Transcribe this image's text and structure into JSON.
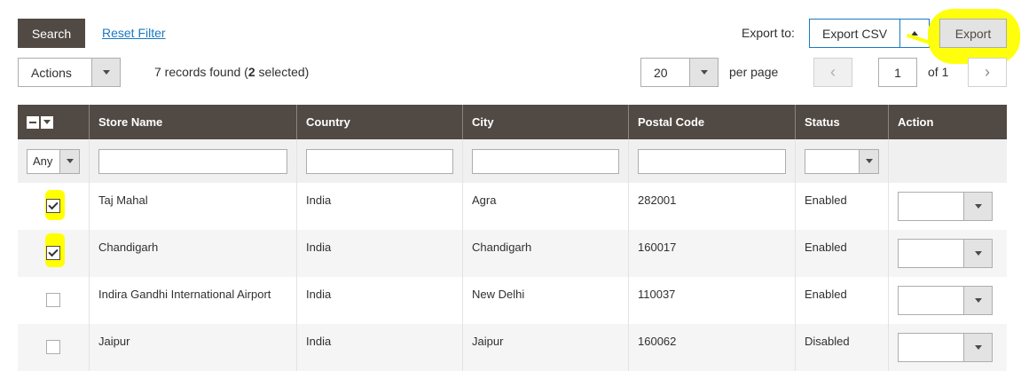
{
  "toolbar": {
    "search_label": "Search",
    "reset_label": "Reset Filter",
    "export_to_label": "Export to:",
    "export_format": "Export CSV",
    "export_label": "Export"
  },
  "secondary": {
    "actions_label": "Actions",
    "records_prefix": "7 records found (",
    "selected_count": "2",
    "records_suffix": " selected)",
    "per_page_value": "20",
    "per_page_label": "per page",
    "page_current": "1",
    "page_of": "of 1"
  },
  "grid": {
    "columns": [
      "Store Name",
      "Country",
      "City",
      "Postal Code",
      "Status",
      "Action"
    ],
    "filter_any": "Any",
    "rows": [
      {
        "store": "Taj Mahal",
        "country": "India",
        "city": "Agra",
        "postal": "282001",
        "status": "Enabled",
        "checked": true
      },
      {
        "store": "Chandigarh",
        "country": "India",
        "city": "Chandigarh",
        "postal": "160017",
        "status": "Enabled",
        "checked": true
      },
      {
        "store": "Indira Gandhi International Airport",
        "country": "India",
        "city": "New Delhi",
        "postal": "110037",
        "status": "Enabled",
        "checked": false
      },
      {
        "store": "Jaipur",
        "country": "India",
        "city": "Jaipur",
        "postal": "160062",
        "status": "Disabled",
        "checked": false
      }
    ]
  },
  "colors": {
    "header_bg": "#514943",
    "link": "#1979c3",
    "highlight": "#ffff00"
  }
}
